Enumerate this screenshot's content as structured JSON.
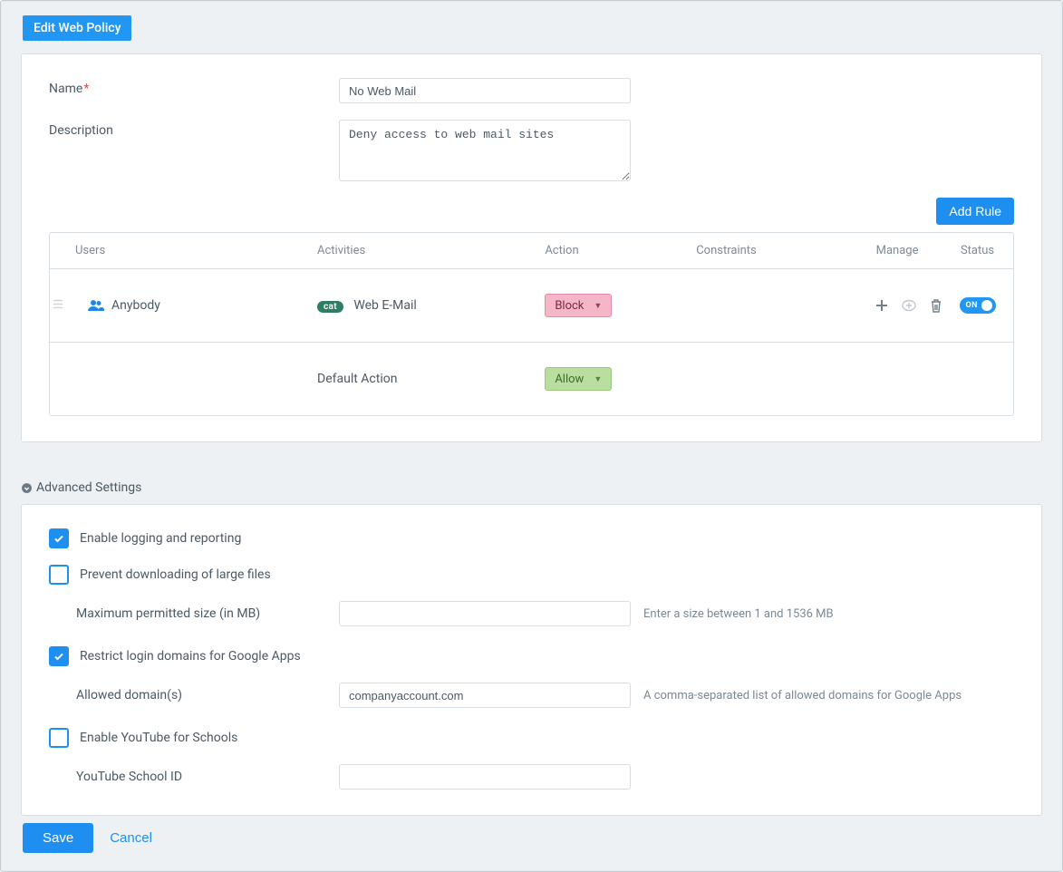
{
  "title": "Edit Web Policy",
  "fields": {
    "name_label": "Name",
    "name_value": "No Web Mail",
    "desc_label": "Description",
    "desc_value": "Deny access to web mail sites"
  },
  "add_rule": "Add Rule",
  "table": {
    "headers": {
      "users": "Users",
      "activities": "Activities",
      "action": "Action",
      "constraints": "Constraints",
      "manage": "Manage",
      "status": "Status"
    },
    "row": {
      "user": "Anybody",
      "cat_badge": "cat",
      "activity": "Web E-Mail",
      "action": "Block",
      "status": "ON"
    },
    "default_row": {
      "label": "Default Action",
      "action": "Allow"
    }
  },
  "advanced": {
    "title": "Advanced Settings",
    "logging_label": "Enable logging and reporting",
    "prevent_label": "Prevent downloading of large files",
    "max_size_label": "Maximum permitted size (in MB)",
    "max_size_helper": "Enter a size between 1 and 1536 MB",
    "restrict_label": "Restrict login domains for Google Apps",
    "allowed_domains_label": "Allowed domain(s)",
    "allowed_domains_value": "companyaccount.com",
    "allowed_domains_helper": "A comma-separated list of allowed domains for Google Apps",
    "youtube_label": "Enable YouTube for Schools",
    "youtube_id_label": "YouTube School ID"
  },
  "footer": {
    "save": "Save",
    "cancel": "Cancel"
  }
}
